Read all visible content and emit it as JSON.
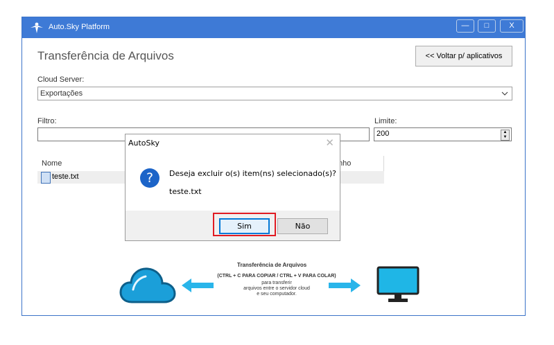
{
  "window": {
    "title": "Auto.Sky Platform",
    "minimize_label": "—",
    "maximize_label": "□",
    "close_label": "X"
  },
  "header": {
    "page_title": "Transferência de Arquivos",
    "back_button": "<< Voltar p/ aplicativos"
  },
  "cloud_server": {
    "label": "Cloud Server:",
    "value": "Exportações"
  },
  "filter": {
    "label": "Filtro:",
    "value": ""
  },
  "limit": {
    "label": "Limite:",
    "value": "200"
  },
  "table": {
    "columns": [
      "Nome",
      "nho"
    ],
    "rows": [
      {
        "name": "teste.txt"
      }
    ]
  },
  "dialog": {
    "title": "AutoSky",
    "close_glyph": "✕",
    "icon_glyph": "?",
    "message": "Deseja excluir o(s) item(ns) selecionado(s)?",
    "file": "teste.txt",
    "yes_button": "Sim",
    "no_button": "Não"
  },
  "banner": {
    "title": "Transferência de Arquivos",
    "line1": "(CTRL + C PARA COPIAR / CTRL + V PARA COLAR)",
    "line2": "para transferir",
    "line3": "arquivos entre o servidor cloud",
    "line4": "e seu computador."
  },
  "colors": {
    "titlebar": "#3e7ad6",
    "cloud": "#1b9fd9",
    "arrow": "#29b5ea",
    "monitor": "#1fb6e6",
    "highlight": "#e11b22"
  }
}
